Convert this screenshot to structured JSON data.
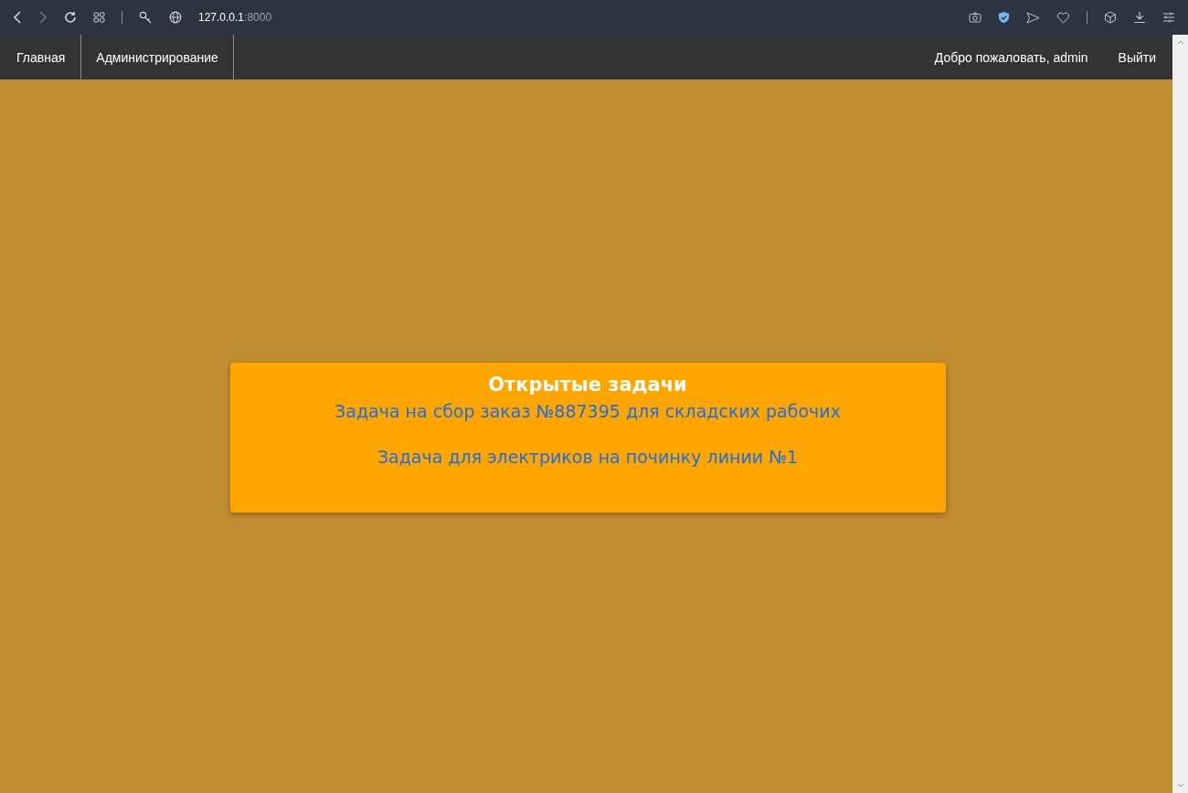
{
  "browser": {
    "address_host": "127.0.0.1",
    "address_port": ":8000"
  },
  "nav": {
    "items": [
      {
        "label": "Главная"
      },
      {
        "label": "Администрирование"
      }
    ],
    "welcome": "Добро пожаловать, admin",
    "logout": "Выйти"
  },
  "tasks_card": {
    "title": "Открытые задачи",
    "tasks": [
      "Задача на сбор заказ №887395 для складских рабочих",
      "Задача для электриков на починку линии №1"
    ]
  }
}
